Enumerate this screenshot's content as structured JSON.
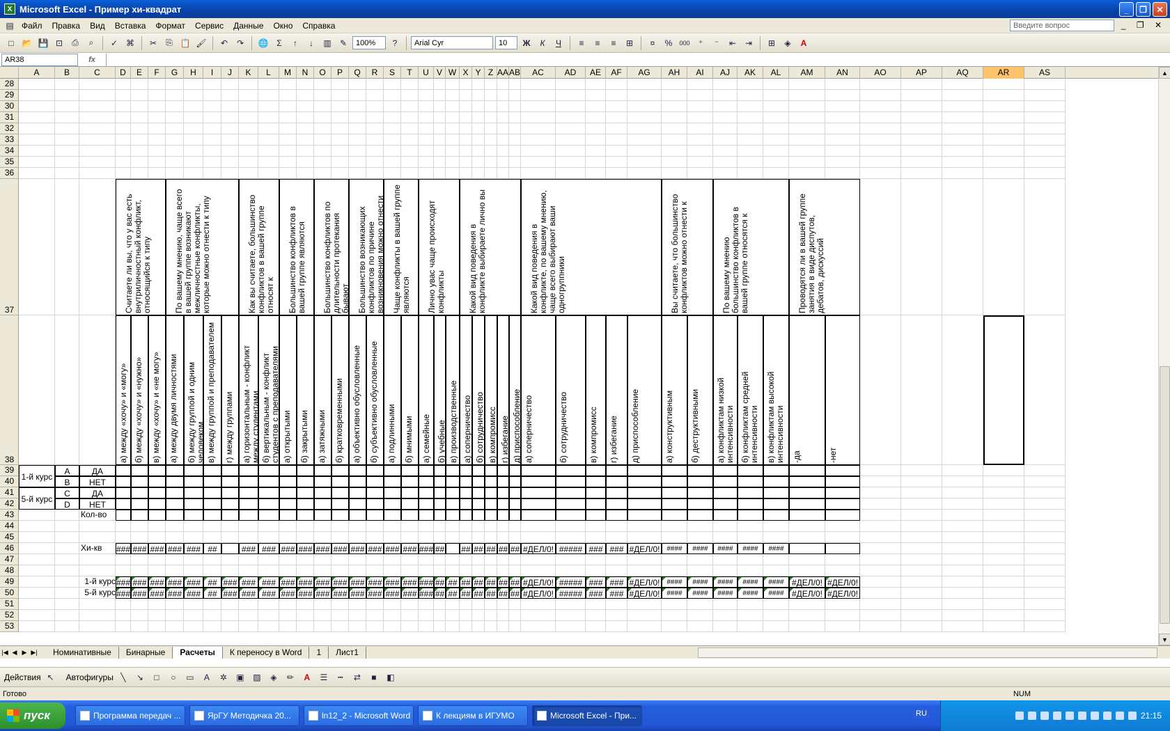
{
  "window": {
    "title": "Microsoft Excel - Пример хи-квадрат",
    "min": "_",
    "max": "❐",
    "close": "✕"
  },
  "menu": [
    "Файл",
    "Правка",
    "Вид",
    "Вставка",
    "Формат",
    "Сервис",
    "Данные",
    "Окно",
    "Справка"
  ],
  "help_placeholder": "Введите вопрос",
  "toolbar": {
    "zoom": "100%",
    "font": "Arial Cyr",
    "size": "10",
    "bold": "Ж",
    "italic": "К",
    "underline": "Ч",
    "sum": "Σ",
    "percent": "%",
    "thousands": "000"
  },
  "formula": {
    "namebox": "AR38",
    "fx": "fx"
  },
  "columns": [
    "A",
    "B",
    "C",
    "D",
    "E",
    "F",
    "G",
    "H",
    "I",
    "J",
    "K",
    "L",
    "M",
    "N",
    "O",
    "P",
    "Q",
    "R",
    "S",
    "T",
    "U",
    "V",
    "W",
    "X",
    "Y",
    "Z",
    "AA",
    "AB",
    "AC",
    "AD",
    "AE",
    "AF",
    "AG",
    "AH",
    "AI",
    "AJ",
    "AK",
    "AL",
    "AM",
    "AN",
    "AO",
    "AP",
    "AQ",
    "AR",
    "AS"
  ],
  "selected_column": "AR",
  "rows": [
    "28",
    "29",
    "30",
    "31",
    "32",
    "33",
    "34",
    "35",
    "36",
    "37",
    "38",
    "39",
    "40",
    "41",
    "42",
    "43",
    "44",
    "45",
    "46",
    "47",
    "48",
    "49",
    "50",
    "51",
    "52",
    "53"
  ],
  "questions": [
    "Считаете ли вы, что у вас есть внутриличностный конфликт, относящийся к типу",
    "По вашему мнению, чаще всего в вашей группе возникают межличностные конфликты, которые можно отнести к типу",
    "Как вы считаете, большинство конфликтов в вашей группе относят к",
    "Большинство конфликтов в вашей группе являются",
    "Большинство конфликтов по длительности протекания бывают",
    "Большинство возникающих конфликтов по причине возникновения можно отнести",
    "Чаще конфликты в вашей группе являются",
    "Лично увас чаще происходят конфликты",
    "Какой вид поведения в конфликте выбираете лично вы",
    "Какой вид поведения в конфликте, по вашему мнению, чаще всего выбирают ваши одногруппники",
    "Вы считаете, что большинство конфликтов можно отнести к",
    "По вашему мнению большинство конфликтов в вашей группе относятся к",
    "Проводятся ли в вашей группе занятия в виде диспутов, дебатов, дискуссий"
  ],
  "answers": [
    "а) между «хочу» и «могу»",
    "б) между «хочу» и «нужно»",
    "в) между «хочу» и «не могу»",
    "а) между двумя личностями",
    "б) между группой и одним человеком",
    "в) между группой и преподавателем",
    "г) между группами",
    "а) горизонтальным - конфликт между студентами",
    "б) вертикальным - конфликт студентов с преподавателями",
    "а) открытыми",
    "б) закрытыми",
    "а) затяжными",
    "б) кратковременными",
    "а) объективно обусловленные",
    "б) субъективно обусловленные",
    "а) подлинными",
    "б) мнимыми",
    "а) семейные",
    "б) учебные",
    "в) производственные",
    "а) соперничество",
    "б) сотрудничество",
    "в) компромисс",
    "г) избегание",
    "д) приспособление",
    "а) соперничество",
    "б) сотрудничество",
    "в) компромисс",
    "г) избегание",
    "д) приспособление",
    "а) конструктивным",
    "б) деструктивными",
    "а) конфликтам низкой интенсивности",
    "б) конфликтам средней интенсивности",
    "в) конфликтам высокой интенсивности",
    "-да",
    "-нет"
  ],
  "labels": {
    "course1": "1-й курс",
    "course5": "5-й курс",
    "A": "A",
    "B": "B",
    "C": "C",
    "D": "D",
    "da": "ДА",
    "net": "НЕТ",
    "kolvo": "Кол-во",
    "hikv": "Хи-кв",
    "row49": "1-й курс",
    "row50": "5-й курс"
  },
  "row46": [
    "###",
    "###",
    "###",
    "###",
    "###",
    "##",
    "",
    "###",
    "###",
    "###",
    "###",
    "###",
    "###",
    "###",
    "###",
    "###",
    "###",
    "###",
    "##",
    "",
    "##",
    "##",
    "##",
    "##",
    "##",
    "#ДЕЛ/0!",
    "#####",
    "###",
    "###",
    "#ДЕЛ/0!",
    "####",
    "####",
    "####",
    "####",
    "####",
    "",
    ""
  ],
  "row49": [
    "###",
    "###",
    "###",
    "###",
    "###",
    "##",
    "###",
    "###",
    "###",
    "###",
    "###",
    "###",
    "###",
    "###",
    "###",
    "###",
    "###",
    "###",
    "##",
    "##",
    "##",
    "##",
    "##",
    "##",
    "##",
    "#ДЕЛ/0!",
    "#####",
    "###",
    "###",
    "#ДЕЛ/0!",
    "####",
    "####",
    "####",
    "####",
    "####",
    "#ДЕЛ/0!",
    "#ДЕЛ/0!"
  ],
  "row50": [
    "###",
    "###",
    "###",
    "###",
    "###",
    "##",
    "###",
    "###",
    "###",
    "###",
    "###",
    "###",
    "###",
    "###",
    "###",
    "###",
    "###",
    "###",
    "##",
    "##",
    "##",
    "##",
    "##",
    "##",
    "##",
    "#ДЕЛ/0!",
    "#####",
    "###",
    "###",
    "#ДЕЛ/0!",
    "####",
    "####",
    "####",
    "####",
    "####",
    "#ДЕЛ/0!",
    "#ДЕЛ/0!"
  ],
  "tabs": [
    "Номинативные",
    "Бинарные",
    "Расчеты",
    "К переносу в Word",
    "1",
    "Лист1"
  ],
  "active_tab": "Расчеты",
  "drawbar": {
    "actions": "Действия",
    "autoshapes": "Автофигуры"
  },
  "status": {
    "ready": "Готово",
    "num": "NUM"
  },
  "taskbar": {
    "start": "пуск",
    "tasks": [
      "Программа передач ...",
      "ЯрГУ Методичка 20...",
      "ln12_2 - Microsoft Word",
      "К лекциям в ИГУМО",
      "Microsoft Excel - При..."
    ],
    "lang": "RU",
    "clock": "21:15"
  }
}
